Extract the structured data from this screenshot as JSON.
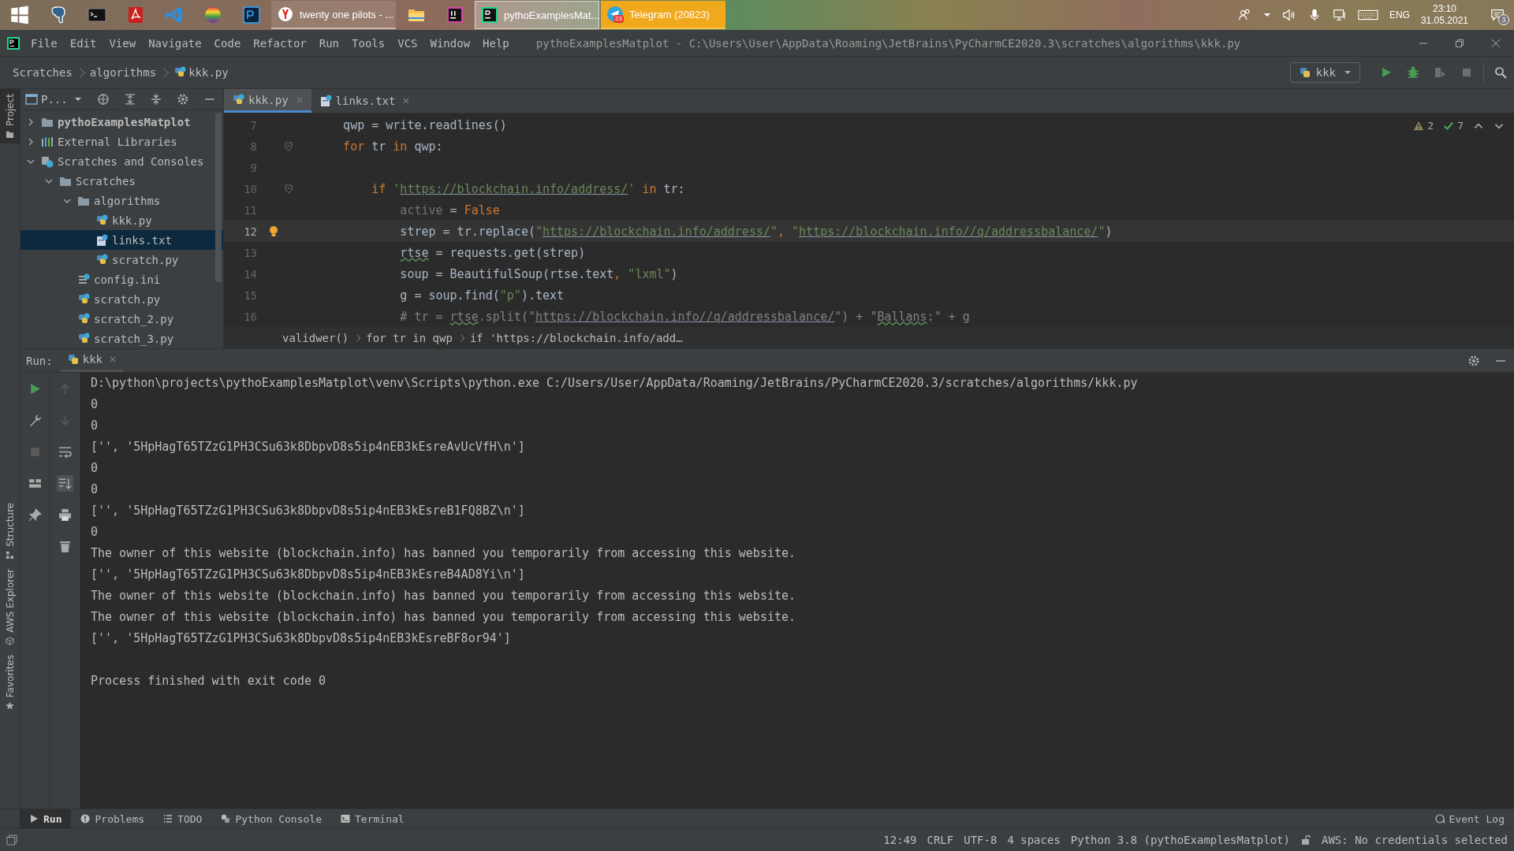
{
  "taskbar": {
    "windows": [
      {
        "title": "twenty one pilots - ...",
        "selected": false,
        "attention": false
      },
      {
        "title": "pythoExamplesMat...",
        "selected": true,
        "attention": false
      },
      {
        "title": "Telegram (20823)",
        "selected": false,
        "attention": true,
        "badge": "23"
      }
    ],
    "tray": {
      "language": "ENG",
      "time": "23:10",
      "date": "31.05.2021",
      "notifications": "3"
    }
  },
  "menu": [
    "File",
    "Edit",
    "View",
    "Navigate",
    "Code",
    "Refactor",
    "Run",
    "Tools",
    "VCS",
    "Window",
    "Help"
  ],
  "window_title": "pythoExamplesMatplot - C:\\Users\\User\\AppData\\Roaming\\JetBrains\\PyCharmCE2020.3\\scratches\\algorithms\\kkk.py",
  "navbar": {
    "breadcrumbs": [
      "Scratches",
      "algorithms",
      "kkk.py"
    ],
    "run_config": "kkk"
  },
  "side_tabs": [
    {
      "label": "Project",
      "selected": true
    },
    {
      "label": "Structure",
      "selected": false
    },
    {
      "label": "AWS Explorer",
      "selected": false
    },
    {
      "label": "Favorites",
      "selected": false
    }
  ],
  "project": {
    "label": "P...",
    "tree": [
      {
        "label": "pythoExamplesMatplot",
        "kind": "module",
        "expanded": false,
        "selected": false
      },
      {
        "label": "External Libraries",
        "kind": "libraries",
        "expanded": false,
        "selected": false
      },
      {
        "label": "Scratches and Consoles",
        "kind": "scratches",
        "expanded": true,
        "selected": false,
        "children": [
          {
            "label": "Scratches",
            "kind": "folder",
            "expanded": true,
            "selected": false,
            "children": [
              {
                "label": "algorithms",
                "kind": "folder",
                "expanded": true,
                "selected": false,
                "children": [
                  {
                    "label": "kkk.py",
                    "kind": "python",
                    "selected": false
                  },
                  {
                    "label": "links.txt",
                    "kind": "text",
                    "selected": true
                  },
                  {
                    "label": "scratch.py",
                    "kind": "python",
                    "selected": false
                  }
                ]
              },
              {
                "label": "config.ini",
                "kind": "config",
                "selected": false
              },
              {
                "label": "scratch.py",
                "kind": "python",
                "selected": false
              },
              {
                "label": "scratch_2.py",
                "kind": "python",
                "selected": false
              },
              {
                "label": "scratch_3.py",
                "kind": "python",
                "selected": false
              }
            ]
          }
        ]
      }
    ]
  },
  "editor": {
    "tabs": [
      {
        "label": "kkk.py",
        "kind": "python",
        "selected": true
      },
      {
        "label": "links.txt",
        "kind": "text",
        "selected": false
      }
    ],
    "inspections": {
      "warnings": "2",
      "passed": "7"
    },
    "lines": [
      {
        "number": "7",
        "fold": false,
        "bulb": false,
        "current": false,
        "tokens": [
          {
            "kind": "plain",
            "text": "    qwp = write.readlines()"
          }
        ]
      },
      {
        "number": "8",
        "fold": true,
        "bulb": false,
        "current": false,
        "tokens": [
          {
            "kind": "kw",
            "text": "    for "
          },
          {
            "kind": "plain",
            "text": "tr "
          },
          {
            "kind": "kw",
            "text": "in "
          },
          {
            "kind": "plain",
            "text": "qwp:"
          }
        ]
      },
      {
        "number": "9",
        "fold": false,
        "bulb": false,
        "current": false
      },
      {
        "number": "10",
        "fold": true,
        "bulb": false,
        "current": false,
        "tokens": [
          {
            "kind": "kw",
            "text": "        if "
          },
          {
            "kind": "str",
            "text": "'"
          },
          {
            "kind": "link",
            "text": "https://blockchain.info/address/"
          },
          {
            "kind": "str",
            "text": "'"
          },
          {
            "kind": "kw",
            "text": " in "
          },
          {
            "kind": "plain",
            "text": "tr:"
          }
        ]
      },
      {
        "number": "11",
        "fold": false,
        "bulb": false,
        "current": false,
        "tokens": [
          {
            "kind": "dim",
            "text": "            active"
          },
          {
            "kind": "plain",
            "text": " = "
          },
          {
            "kind": "kw",
            "text": "False"
          }
        ]
      },
      {
        "number": "12",
        "fold": false,
        "bulb": true,
        "current": true,
        "tokens": [
          {
            "kind": "plain",
            "text": "            strep = tr.replace("
          },
          {
            "kind": "str",
            "text": "\""
          },
          {
            "kind": "link",
            "text": "https://blockchain.info/address/"
          },
          {
            "kind": "str",
            "text": "\""
          },
          {
            "kind": "kw",
            "text": ", "
          },
          {
            "kind": "str",
            "text": "\""
          },
          {
            "kind": "link",
            "text": "https://blockchain.info//q/addressbalance/"
          },
          {
            "kind": "str",
            "text": "\""
          },
          {
            "kind": "plain",
            "text": ")"
          }
        ]
      },
      {
        "number": "13",
        "fold": false,
        "bulb": false,
        "current": false,
        "tokens": [
          {
            "kind": "typo",
            "text": "            rtse"
          },
          {
            "kind": "plain",
            "text": " = requests.get(strep)"
          }
        ]
      },
      {
        "number": "14",
        "fold": false,
        "bulb": false,
        "current": false,
        "tokens": [
          {
            "kind": "plain",
            "text": "            soup = BeautifulSoup(rtse.text"
          },
          {
            "kind": "kw",
            "text": ", "
          },
          {
            "kind": "str",
            "text": "\"lxml\""
          },
          {
            "kind": "plain",
            "text": ")"
          }
        ]
      },
      {
        "number": "15",
        "fold": false,
        "bulb": false,
        "current": false,
        "tokens": [
          {
            "kind": "plain",
            "text": "            g = soup.find("
          },
          {
            "kind": "str",
            "text": "\"p\""
          },
          {
            "kind": "plain",
            "text": ").text"
          }
        ]
      },
      {
        "number": "16",
        "fold": false,
        "bulb": false,
        "current": false,
        "tokens": [
          {
            "kind": "cmt",
            "text": "            # tr = "
          },
          {
            "kind": "cmttypo",
            "text": "rtse"
          },
          {
            "kind": "cmt",
            "text": ".split(\""
          },
          {
            "kind": "cmtlink",
            "text": "https://blockchain.info//q/addressbalance/"
          },
          {
            "kind": "cmt",
            "text": "\") + \""
          },
          {
            "kind": "cmttypo",
            "text": "Ballans"
          },
          {
            "kind": "cmt",
            "text": ":\" + g"
          }
        ]
      }
    ],
    "breadcrumbs": [
      "validwer()",
      "for tr in qwp",
      "if 'https://blockchain.info/add…"
    ]
  },
  "run": {
    "label": "Run:",
    "tabs": [
      {
        "label": "kkk",
        "selected": true
      }
    ],
    "output": [
      {
        "kind": "command",
        "text": "D:\\python\\projects\\pythoExamplesMatplot\\venv\\Scripts\\python.exe C:/Users/User/AppData/Roaming/JetBrains/PyCharmCE2020.3/scratches/algorithms/kkk.py"
      },
      {
        "kind": "text",
        "text": "0"
      },
      {
        "kind": "text",
        "text": "0"
      },
      {
        "kind": "text",
        "text": "['', '5HpHagT65TZzG1PH3CSu63k8DbpvD8s5ip4nEB3kEsreAvUcVfH\\n']"
      },
      {
        "kind": "text",
        "text": "0"
      },
      {
        "kind": "text",
        "text": "0"
      },
      {
        "kind": "text",
        "text": "['', '5HpHagT65TZzG1PH3CSu63k8DbpvD8s5ip4nEB3kEsreB1FQ8BZ\\n']"
      },
      {
        "kind": "text",
        "text": "0"
      },
      {
        "kind": "text",
        "text": "The owner of this website (blockchain.info) has banned you temporarily from accessing this website."
      },
      {
        "kind": "text",
        "text": "['', '5HpHagT65TZzG1PH3CSu63k8DbpvD8s5ip4nEB3kEsreB4AD8Yi\\n']"
      },
      {
        "kind": "text",
        "text": "The owner of this website (blockchain.info) has banned you temporarily from accessing this website."
      },
      {
        "kind": "text",
        "text": "The owner of this website (blockchain.info) has banned you temporarily from accessing this website."
      },
      {
        "kind": "text",
        "text": "['', '5HpHagT65TZzG1PH3CSu63k8DbpvD8s5ip4nEB3kEsreBF8or94']"
      },
      {
        "kind": "exit",
        "text": "Process finished with exit code 0"
      }
    ]
  },
  "tool_tabs": [
    {
      "label": "Run",
      "selected": true
    },
    {
      "label": "Problems",
      "selected": false
    },
    {
      "label": "TODO",
      "selected": false
    },
    {
      "label": "Python Console",
      "selected": false
    },
    {
      "label": "Terminal",
      "selected": false
    }
  ],
  "event_log": "Event Log",
  "status_bar": [
    "12:49",
    "CRLF",
    "UTF-8",
    "4 spaces",
    "Python 3.8 (pythoExamplesMatplot)",
    "AWS: No credentials selected"
  ]
}
